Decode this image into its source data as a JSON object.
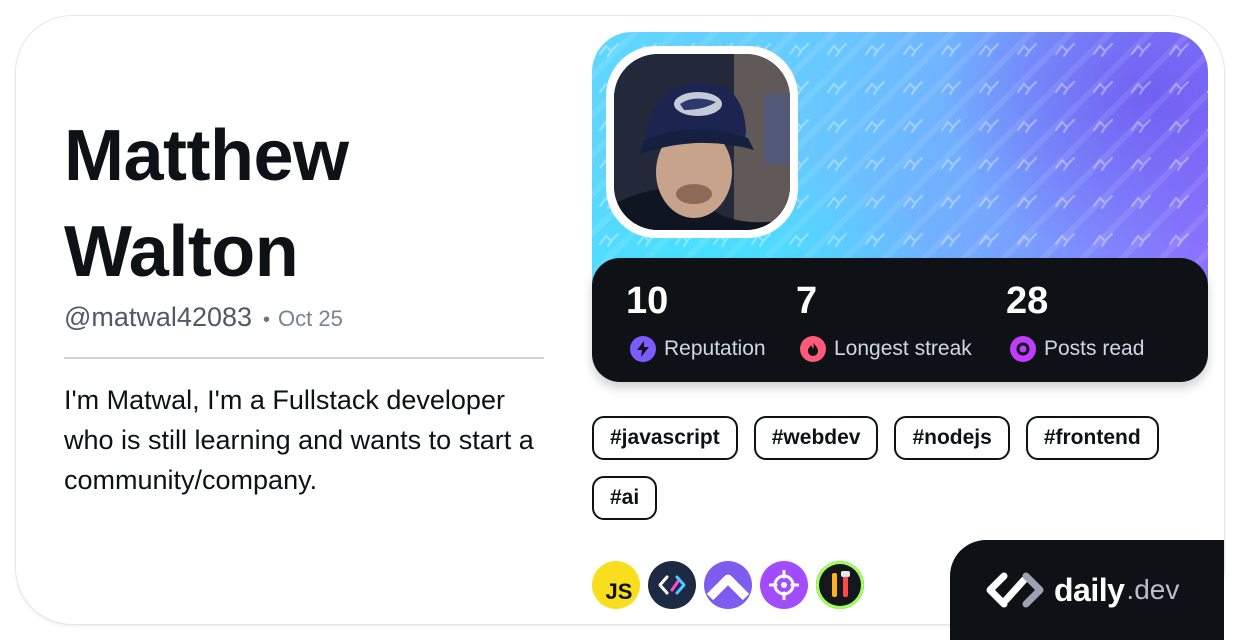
{
  "profile": {
    "first_name": "Matthew",
    "last_name": "Walton",
    "handle": "@matwal42083",
    "separator": "•",
    "joined": "Oct 25",
    "bio": "I'm Matwal, I'm a Fullstack developer who is still learning and wants to start a community/company."
  },
  "stats": [
    {
      "value": "10",
      "label": "Reputation",
      "icon": "lightning-icon",
      "color": "#7b5cff"
    },
    {
      "value": "7",
      "label": "Longest streak",
      "icon": "flame-icon",
      "color": "#ff5a7a"
    },
    {
      "value": "28",
      "label": "Posts read",
      "icon": "ring-icon",
      "color": "#c13cff"
    }
  ],
  "tags": [
    "#javascript",
    "#webdev",
    "#nodejs",
    "#frontend",
    "#ai"
  ],
  "squads": [
    {
      "icon": "js-icon",
      "text": "JS",
      "color": "#f7df1e"
    },
    {
      "icon": "dailydev-squad-icon",
      "color": "#1e2a44"
    },
    {
      "icon": "up-arrow-icon",
      "color": "#7e5cf0"
    },
    {
      "icon": "target-icon",
      "color": "#a24cff"
    },
    {
      "icon": "tools-icon",
      "color": "#15171c"
    }
  ],
  "brand": {
    "name": "daily",
    "tld": ".dev"
  },
  "colors": {
    "text": "#0e1217",
    "muted": "#525866",
    "stats_bg": "#0e1217",
    "cover_start": "#5fd7ff",
    "cover_end": "#8f6fff"
  }
}
